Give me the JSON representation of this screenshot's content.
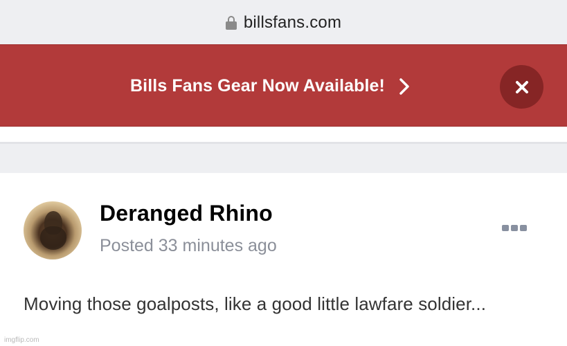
{
  "browser": {
    "url": "billsfans.com",
    "lock_icon": "lock-icon"
  },
  "banner": {
    "text": "Bills Fans Gear Now Available!",
    "background": "#b23a3a",
    "close_icon": "close-icon",
    "chevron_icon": "chevron-right-icon"
  },
  "post": {
    "author": "Deranged Rhino",
    "posted": "Posted 33 minutes ago",
    "body": "Moving those goalposts, like a good little lawfare soldier...",
    "more_icon": "more-options-icon"
  },
  "watermark": "imgflip.com"
}
